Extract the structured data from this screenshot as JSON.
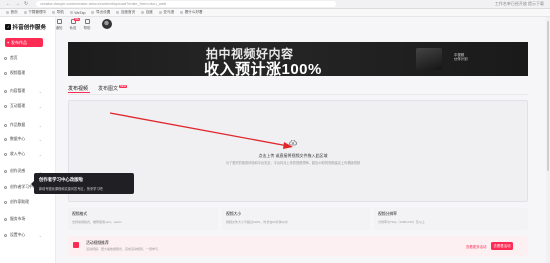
{
  "browser": {
    "address": "creator.douyin.com/creator-micro/content/upload?enter_from=dou_web",
    "bookmarks": [
      "首页",
      "下载管理中",
      "导航",
      "WeTap",
      "导出设置",
      "百度首页",
      "百度",
      "亚马逊",
      "看什么好看"
    ],
    "right_text": "工作名单已经开放 提示下载"
  },
  "sidebar": {
    "logo_text": "抖音创作服务",
    "publish_label": "发布作品",
    "items": [
      {
        "label": "首页",
        "chevron": false
      },
      {
        "label": "视频管理",
        "chevron": false
      },
      {
        "label": "内容管理",
        "chevron": true
      },
      {
        "label": "互动管理",
        "chevron": true
      },
      {
        "label": "作品数据",
        "chevron": true
      },
      {
        "label": "数据中心",
        "chevron": true
      },
      {
        "label": "收入中心",
        "chevron": true
      },
      {
        "label": "创作灵感",
        "chevron": true
      },
      {
        "label": "创作者学习中心",
        "chevron": false
      },
      {
        "label": "创作家助理",
        "chevron": false
      },
      {
        "label": "服务市场",
        "chevron": false
      },
      {
        "label": "设置中心",
        "chevron": true
      }
    ]
  },
  "header": {
    "icons": [
      {
        "label": "通知",
        "badge": ""
      },
      {
        "label": "私信",
        "badge": "99+"
      },
      {
        "label": "帮助",
        "badge": ""
      }
    ]
  },
  "banner": {
    "line1": "拍中视频好内容",
    "line2": "收入预计涨100%",
    "side_line1": "中视频",
    "side_line2": "伙伴计划"
  },
  "tabs": [
    {
      "label": "发布视频",
      "active": true,
      "badge": ""
    },
    {
      "label": "发布图文",
      "active": false,
      "badge": "NEW"
    }
  ],
  "upload": {
    "title": "点击上传 或直接将视频文件拖入此区域",
    "desc": "为了更好的观看体验和平台安全，平台将对上传的视频预审。超出40秒的视频建议上传横版视频"
  },
  "cards": [
    {
      "title": "视频格式",
      "desc": "支持常用格式，推荐使用mp4、webm"
    },
    {
      "title": "视频大小",
      "desc": "视频文件大小不超过128G，时长在60分钟以内"
    },
    {
      "title": "视频分辨率",
      "desc": "分辨率为720p（1280x720）及以上"
    }
  ],
  "notice": {
    "title": "活动视频推荐",
    "desc": "活动视频，更大播放量曝光，完成活动规则，一键参与",
    "link": "查看更多活动",
    "button": "去看看活动"
  },
  "tooltip": {
    "title": "创作者学习中心改版啦",
    "desc": "新增专题化课程和实操问答专区，快来学习吧"
  },
  "colors": {
    "accent": "#fe2c55",
    "tooltip_bg": "#1f1f24",
    "arrow": "#e0262b"
  }
}
